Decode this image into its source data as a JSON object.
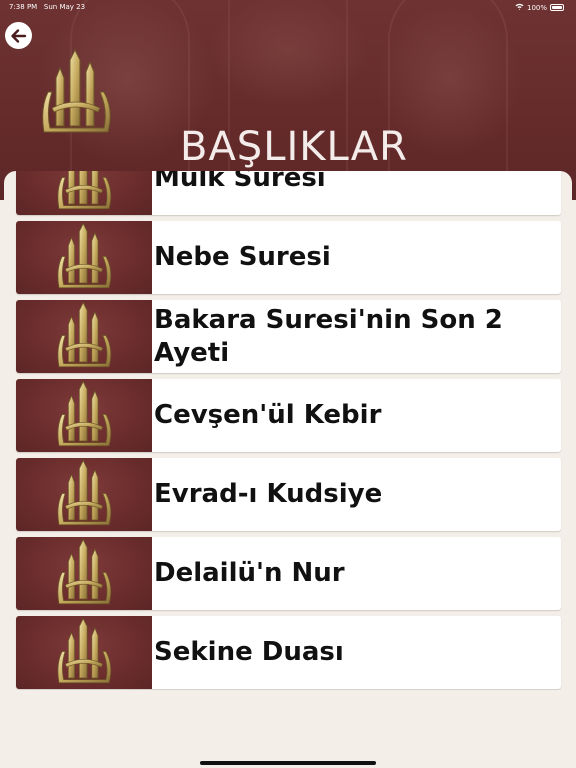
{
  "status_bar": {
    "time": "7:38 PM",
    "date": "Sun May 23",
    "battery": "100%"
  },
  "header": {
    "title": "BAŞLIKLAR",
    "back_icon": "arrow-left-icon",
    "logo_icon": "allah-calligraphy-icon"
  },
  "items": [
    {
      "label": "Mulk Suresi",
      "icon": "allah-calligraphy-icon"
    },
    {
      "label": "Nebe Suresi",
      "icon": "allah-calligraphy-icon"
    },
    {
      "label": "Bakara Suresi'nin Son 2 Ayeti",
      "icon": "allah-calligraphy-icon"
    },
    {
      "label": "Cevşen'ül Kebir",
      "icon": "allah-calligraphy-icon"
    },
    {
      "label": "Evrad-ı Kudsiye",
      "icon": "allah-calligraphy-icon"
    },
    {
      "label": "Delailü'n Nur",
      "icon": "allah-calligraphy-icon"
    },
    {
      "label": "Sekine Duası",
      "icon": "allah-calligraphy-icon"
    }
  ],
  "colors": {
    "header_bg": "#652b2b",
    "thumb_bg": "#6a2c2c",
    "gold": "#c9b06a",
    "page_bg": "#f4eee8"
  }
}
